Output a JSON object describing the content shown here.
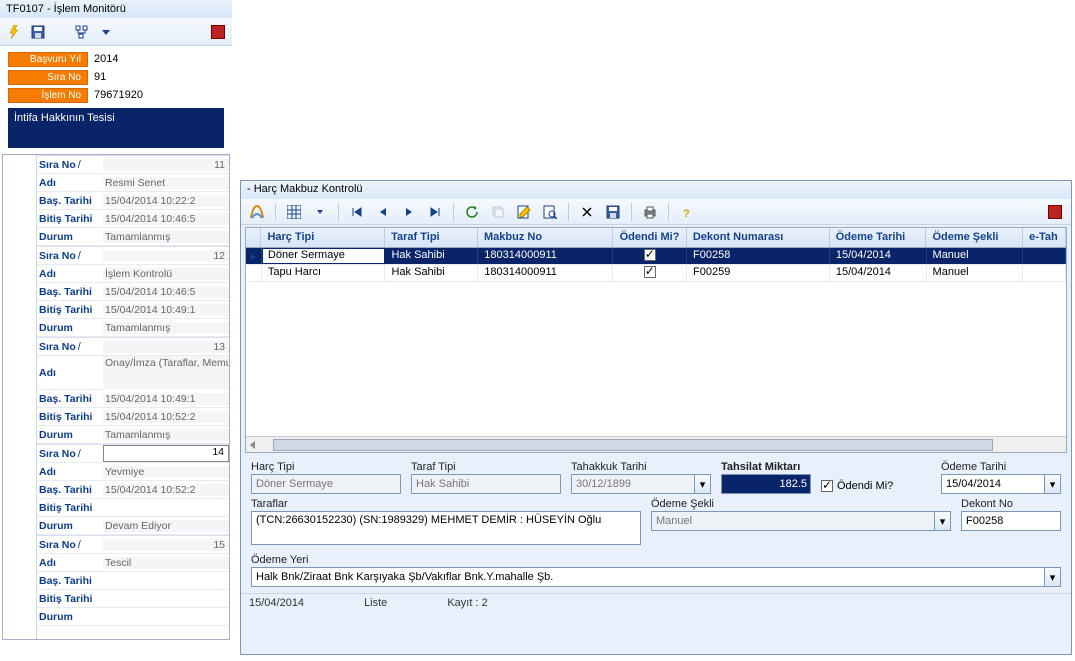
{
  "left": {
    "windowTitle": "TF0107 - İşlem Monitörü",
    "header": {
      "rows": [
        {
          "label": "Başvuru Yıl",
          "value": "2014"
        },
        {
          "label": "Sıra No",
          "value": "91"
        },
        {
          "label": "İşlem No",
          "value": "79671920"
        }
      ],
      "caption": "İntifa Hakkının Tesisi"
    },
    "cards": [
      {
        "sira": "11",
        "adi": "Resmi Senet",
        "bas": "15/04/2014 10:22:2",
        "bit": "15/04/2014 10:46:5",
        "durum": "Tamamlanmış"
      },
      {
        "sira": "12",
        "adi": "İşlem Kontrolü",
        "bas": "15/04/2014 10:46:5",
        "bit": "15/04/2014 10:49:1",
        "durum": "Tamamlanmış"
      },
      {
        "sira": "13",
        "adi": "Onay/İmza (Taraflar, Memur, Md. Yrd., Müdür)",
        "bas": "15/04/2014 10:49:1",
        "bit": "15/04/2014 10:52:2",
        "durum": "Tamamlanmış"
      },
      {
        "sira": "14",
        "adi": "Yevmiye",
        "bas": "15/04/2014 10:52:2",
        "bit": "",
        "durum": "Devam Ediyor",
        "active": true
      },
      {
        "sira": "15",
        "adi": "Tescil",
        "bas": "",
        "bit": "",
        "durum": ""
      }
    ],
    "labels": {
      "sira": "Sıra No",
      "adi": "Adı",
      "bas": "Baş. Tarihi",
      "bit": "Bitiş Tarihi",
      "durum": "Durum",
      "slash": "/"
    }
  },
  "detail": {
    "windowTitle": "- Harç Makbuz Kontrolü",
    "grid": {
      "headers": [
        "Harç Tipi",
        "Taraf Tipi",
        "Makbuz No",
        "Ödendi Mi?",
        "Dekont Numarası",
        "Ödeme Tarihi",
        "Ödeme Şekli",
        "e-Tah"
      ],
      "rows": [
        {
          "harcTipi": "Döner Sermaye",
          "tarafTipi": "Hak Sahibi",
          "makbuz": "180314000911",
          "odendi": true,
          "dekont": "F00258",
          "odemeTarihi": "15/04/2014",
          "odemeSekli": "Manuel",
          "selected": true
        },
        {
          "harcTipi": "Tapu Harcı",
          "tarafTipi": "Hak Sahibi",
          "makbuz": "180314000911",
          "odendi": true,
          "dekont": "F00259",
          "odemeTarihi": "15/04/2014",
          "odemeSekli": "Manuel",
          "selected": false
        }
      ]
    },
    "form": {
      "labels": {
        "harcTipi": "Harç Tipi",
        "tarafTipi": "Taraf Tipi",
        "tahakkuk": "Tahakkuk Tarihi",
        "tahsilat": "Tahsilat Miktarı",
        "odendiMi": "Ödendi Mi?",
        "odemeTarihi": "Ödeme Tarihi",
        "taraflar": "Taraflar",
        "odemeSekli": "Ödeme Şekli",
        "dekontNo": "Dekont No",
        "odemeYeri": "Ödeme Yeri"
      },
      "harcTipi": "Döner Sermaye",
      "tarafTipi": "Hak Sahibi",
      "tahakkuk": "30/12/1899",
      "tahsilat": "182.5",
      "odendiMi": true,
      "odemeTarihi": "15/04/2014",
      "taraflar": "(TCN:26630152230) (SN:1989329) MEHMET DEMİR : HÜSEYİN Oğlu",
      "odemeSekli": "Manuel",
      "dekontNo": "F00258",
      "odemeYeri": "Halk Bnk/Ziraat Bnk Karşıyaka Şb/Vakıflar Bnk.Y.mahalle Şb."
    },
    "status": {
      "date": "15/04/2014",
      "mode": "Liste",
      "countLabel": "Kayıt : ",
      "count": "2"
    }
  }
}
